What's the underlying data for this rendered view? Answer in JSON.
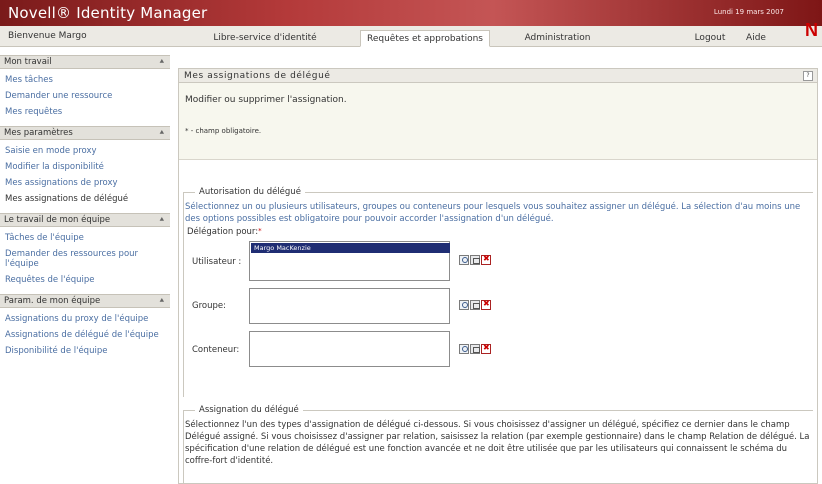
{
  "header": {
    "app_title": "Novell® Identity Manager",
    "date": "Lundi 19 mars 2007",
    "welcome": "Bienvenue Margo",
    "tabs": [
      "Libre-service d'identité",
      "Requêtes et approbations",
      "Administration"
    ],
    "logout": "Logout",
    "help": "Aide",
    "brand_letter": "N"
  },
  "sidebar": {
    "sections": [
      {
        "title": "Mon travail",
        "items": [
          "Mes tâches",
          "Demander une ressource",
          "Mes requêtes"
        ]
      },
      {
        "title": "Mes paramètres",
        "items": [
          "Saisie en mode proxy",
          "Modifier la disponibilité",
          "Mes assignations de proxy",
          "Mes assignations de délégué"
        ]
      },
      {
        "title": "Le travail de mon équipe",
        "items": [
          "Tâches de l'équipe",
          "Demander des ressources pour l'équipe",
          "Requêtes de l'équipe"
        ]
      },
      {
        "title": "Param. de mon équipe",
        "items": [
          "Assignations du proxy de l'équipe",
          "Assignations de délégué de l'équipe",
          "Disponibilité de l'équipe"
        ]
      }
    ]
  },
  "main": {
    "title": "Mes assignations de délégué",
    "help_icon": "help-icon",
    "description": "Modifier ou supprimer l'assignation.",
    "required_note": "* - champ obligatoire.",
    "autorisation": {
      "legend": "Autorisation du délégué",
      "text": "Sélectionnez un ou plusieurs utilisateurs, groupes ou conteneurs pour lesquels vous souhaitez assigner un délégué. La sélection d'au moins une des options possibles est obligatoire pour pouvoir accorder l'assignation d'un délégué.",
      "delegation_label": "Délégation pour:",
      "required_mark": "*",
      "fields": [
        {
          "label": "Utilisateur :",
          "value": "Margo MacKenzie"
        },
        {
          "label": "Groupe:",
          "value": ""
        },
        {
          "label": "Conteneur:",
          "value": ""
        }
      ]
    },
    "assignation": {
      "legend": "Assignation du délégué",
      "text": "Sélectionnez l'un des types d'assignation de délégué ci-dessous. Si vous choisissez d'assigner un délégué, spécifiez ce dernier dans le champ Délégué assigné. Si vous choisissez d'assigner par relation, saisissez la relation (par exemple gestionnaire) dans le champ Relation de délégué. La spécification d'une relation de délégué est une fonction avancée et ne doit être utilisée que par les utilisateurs qui connaissent le schéma du coffre-fort d'identité."
    }
  }
}
